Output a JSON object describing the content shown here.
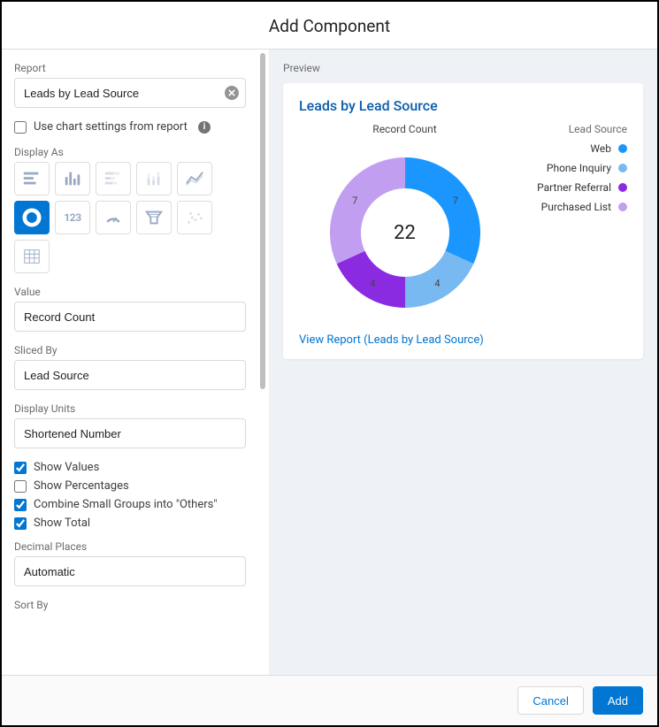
{
  "header": {
    "title": "Add Component"
  },
  "form": {
    "report_label": "Report",
    "report_value": "Leads by Lead Source",
    "use_chart_settings_label": "Use chart settings from report",
    "display_as_label": "Display As",
    "value_label": "Value",
    "value_value": "Record Count",
    "sliced_by_label": "Sliced By",
    "sliced_by_value": "Lead Source",
    "display_units_label": "Display Units",
    "display_units_value": "Shortened Number",
    "checkboxes": {
      "show_values": "Show Values",
      "show_percentages": "Show Percentages",
      "combine_small": "Combine Small Groups into \"Others\"",
      "show_total": "Show Total"
    },
    "decimal_label": "Decimal Places",
    "decimal_value": "Automatic",
    "sort_by_label": "Sort By"
  },
  "chart_icons": {
    "metric_label": "123"
  },
  "preview": {
    "label": "Preview",
    "title": "Leads by Lead Source",
    "chart_title": "Record Count",
    "legend_title": "Lead Source",
    "view_report": "View Report (Leads by Lead Source)"
  },
  "chart_data": {
    "type": "donut",
    "title": "Record Count",
    "total": 22,
    "series": [
      {
        "name": "Web",
        "value": 7,
        "color": "#1b96ff"
      },
      {
        "name": "Phone Inquiry",
        "value": 4,
        "color": "#78b9f2"
      },
      {
        "name": "Partner Referral",
        "value": 4,
        "color": "#8a2be2"
      },
      {
        "name": "Purchased List",
        "value": 7,
        "color": "#c29ef0"
      }
    ]
  },
  "footer": {
    "cancel": "Cancel",
    "add": "Add"
  }
}
